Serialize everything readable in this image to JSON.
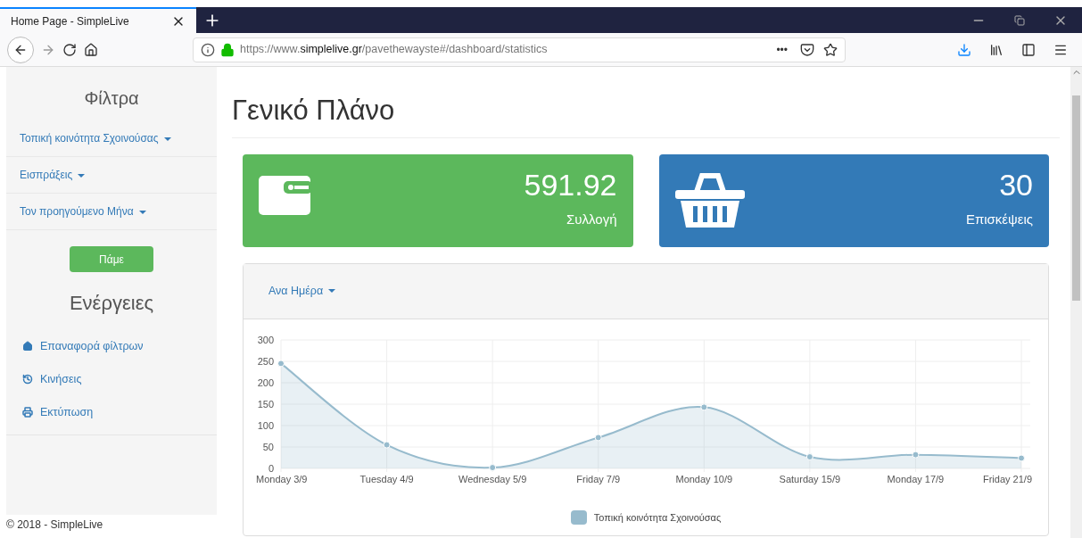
{
  "browser": {
    "tab_title": "Home Page - SimpleLive",
    "url_prefix": "https://www.",
    "url_domain": "simplelive.gr",
    "url_path": "/pavethewayste#/dashboard/statistics",
    "page_actions": "•••"
  },
  "sidebar": {
    "filters_title": "Φίλτρα",
    "filters": [
      {
        "label": "Τοπική κοινότητα Σχοινούσας"
      },
      {
        "label": "Εισπράξεις"
      },
      {
        "label": "Τον προηγούμενο Μήνα"
      }
    ],
    "go_button": "Πάμε",
    "actions_title": "Ενέργειες",
    "actions": [
      {
        "kind": "home",
        "label": "Επαναφορά φίλτρων"
      },
      {
        "kind": "history",
        "label": "Κινήσεις"
      },
      {
        "kind": "print",
        "label": "Εκτύπωση"
      }
    ],
    "footer": "© 2018 - SimpleLive"
  },
  "main": {
    "title": "Γενικό Πλάνο",
    "stats": [
      {
        "kind": "wallet",
        "value": "591.92",
        "label": "Συλλογή",
        "color": "#5cb85c"
      },
      {
        "kind": "basket",
        "value": "30",
        "label": "Επισκέψεις",
        "color": "#337ab7"
      }
    ],
    "panel": {
      "dropdown": "Ανα Ημέρα",
      "chart_data": {
        "type": "area",
        "categories": [
          "Monday 3/9",
          "Tuesday 4/9",
          "Wednesday 5/9",
          "Friday 7/9",
          "Monday 10/9",
          "Saturday 15/9",
          "Monday 17/9",
          "Friday 21/9"
        ],
        "series": [
          {
            "name": "Τοπική κοινότητα Σχοινούσας",
            "color": "#97bbcd",
            "values": [
              245,
              55,
              2,
              72,
              143,
              27,
              32,
              24
            ]
          }
        ],
        "grid": true,
        "ylim": [
          0,
          300
        ],
        "yticks": [
          0,
          50,
          100,
          150,
          200,
          250,
          300
        ]
      }
    }
  }
}
